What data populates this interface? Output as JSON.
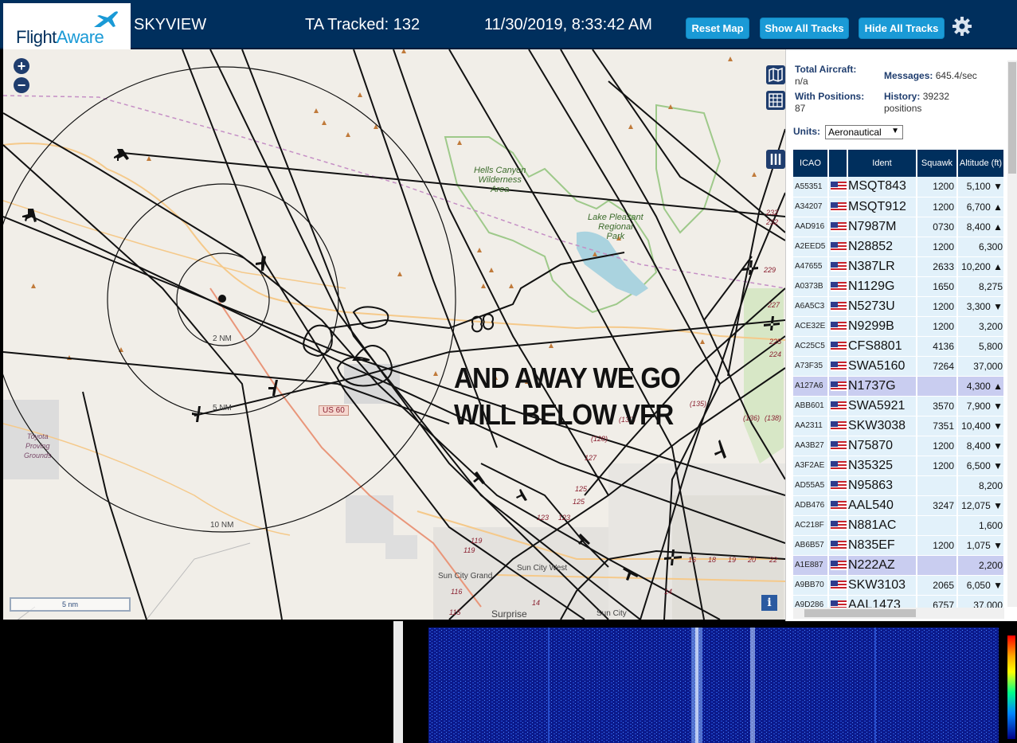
{
  "header": {
    "logo_flight": "Flight",
    "logo_aware": "Aware",
    "site_name": "SKYVIEW",
    "tracked_label": "TA Tracked:",
    "tracked_value": "132",
    "datetime": "11/30/2019, 8:33:42 AM",
    "buttons": {
      "reset": "Reset Map",
      "show_all": "Show All Tracks",
      "hide_all": "Hide All Tracks"
    },
    "settings_icon": "gear-icon"
  },
  "map": {
    "zoom_in": "+",
    "zoom_out": "−",
    "scale_label": "5 nm",
    "overlay_line1": "AND AWAY WE GO",
    "overlay_line2": "WILL BELOW VFR",
    "range_rings": [
      "2 NM",
      "5 NM",
      "10 NM"
    ],
    "labels": {
      "hells_canyon": "Hells Canyon\nWilderness\nArea",
      "lake_pleasant": "Lake Pleasant\nRegional\nPark",
      "toyota": "Toyota\nProving\nGrounds",
      "sun_city_grand": "Sun City Grand",
      "sun_city_west": "Sun City West",
      "surprise": "Surprise",
      "sun_city": "Sun City",
      "us60": "US 60"
    },
    "route_numbers": [
      "232",
      "232",
      "229",
      "227",
      "225",
      "224",
      "(135)",
      "(136)",
      "(138)",
      "(128)",
      "127",
      "(130)",
      "125",
      "125",
      "123",
      "123",
      "119",
      "119",
      "116",
      "115",
      "14",
      "16",
      "18",
      "19",
      "20",
      "22",
      "14"
    ],
    "info": "i"
  },
  "sidebar": {
    "total_aircraft_label": "Total Aircraft:",
    "total_aircraft_value": "n/a",
    "messages_label": "Messages:",
    "messages_value": "645.4/sec",
    "with_positions_label": "With Positions:",
    "with_positions_value": "87",
    "history_label": "History:",
    "history_value": "39232",
    "history_unit": "positions",
    "units_label": "Units:",
    "units_value": "Aeronautical",
    "columns": [
      "ICAO",
      "",
      "Ident",
      "Squawk",
      "Altitude (ft)"
    ],
    "rows": [
      {
        "icao": "A55351",
        "ident": "MSQT843",
        "squawk": "1200",
        "alt": "5,100",
        "trend": "▼",
        "sel": false
      },
      {
        "icao": "A34207",
        "ident": "MSQT912",
        "squawk": "1200",
        "alt": "6,700",
        "trend": "▲",
        "sel": false
      },
      {
        "icao": "AAD916",
        "ident": "N7987M",
        "squawk": "0730",
        "alt": "8,400",
        "trend": "▲",
        "sel": false
      },
      {
        "icao": "A2EED5",
        "ident": "N28852",
        "squawk": "1200",
        "alt": "6,300",
        "trend": "",
        "sel": false
      },
      {
        "icao": "A47655",
        "ident": "N387LR",
        "squawk": "2633",
        "alt": "10,200",
        "trend": "▲",
        "sel": false
      },
      {
        "icao": "A0373B",
        "ident": "N1129G",
        "squawk": "1650",
        "alt": "8,275",
        "trend": "",
        "sel": false
      },
      {
        "icao": "A6A5C3",
        "ident": "N5273U",
        "squawk": "1200",
        "alt": "3,300",
        "trend": "▼",
        "sel": false
      },
      {
        "icao": "ACE32E",
        "ident": "N9299B",
        "squawk": "1200",
        "alt": "3,200",
        "trend": "",
        "sel": false
      },
      {
        "icao": "AC25C5",
        "ident": "CFS8801",
        "squawk": "4136",
        "alt": "5,800",
        "trend": "",
        "sel": false
      },
      {
        "icao": "A73F35",
        "ident": "SWA5160",
        "squawk": "7264",
        "alt": "37,000",
        "trend": "",
        "sel": false
      },
      {
        "icao": "A127A6",
        "ident": "N1737G",
        "squawk": "",
        "alt": "4,300",
        "trend": "▲",
        "sel": true
      },
      {
        "icao": "ABB601",
        "ident": "SWA5921",
        "squawk": "3570",
        "alt": "7,900",
        "trend": "▼",
        "sel": false
      },
      {
        "icao": "AA2311",
        "ident": "SKW3038",
        "squawk": "7351",
        "alt": "10,400",
        "trend": "▼",
        "sel": false
      },
      {
        "icao": "AA3B27",
        "ident": "N75870",
        "squawk": "1200",
        "alt": "8,400",
        "trend": "▼",
        "sel": false
      },
      {
        "icao": "A3F2AE",
        "ident": "N35325",
        "squawk": "1200",
        "alt": "6,500",
        "trend": "▼",
        "sel": false
      },
      {
        "icao": "AD55A5",
        "ident": "N95863",
        "squawk": "",
        "alt": "8,200",
        "trend": "",
        "sel": false
      },
      {
        "icao": "ADB476",
        "ident": "AAL540",
        "squawk": "3247",
        "alt": "12,075",
        "trend": "▼",
        "sel": false
      },
      {
        "icao": "AC218F",
        "ident": "N881AC",
        "squawk": "",
        "alt": "1,600",
        "trend": "",
        "sel": false
      },
      {
        "icao": "AB6B57",
        "ident": "N835EF",
        "squawk": "1200",
        "alt": "1,075",
        "trend": "▼",
        "sel": false
      },
      {
        "icao": "A1E887",
        "ident": "N222AZ",
        "squawk": "",
        "alt": "2,200",
        "trend": "",
        "sel": true
      },
      {
        "icao": "A9BB70",
        "ident": "SKW3103",
        "squawk": "2065",
        "alt": "6,050",
        "trend": "▼",
        "sel": false
      },
      {
        "icao": "A9D286",
        "ident": "AAL1473",
        "squawk": "6757",
        "alt": "37,000",
        "trend": "",
        "sel": false
      }
    ]
  },
  "colors": {
    "header_bg": "#002f5d",
    "button_bg": "#1a9ad6",
    "row_bg": "#e2f1fa",
    "row_selected_bg": "#c9cdf0"
  }
}
